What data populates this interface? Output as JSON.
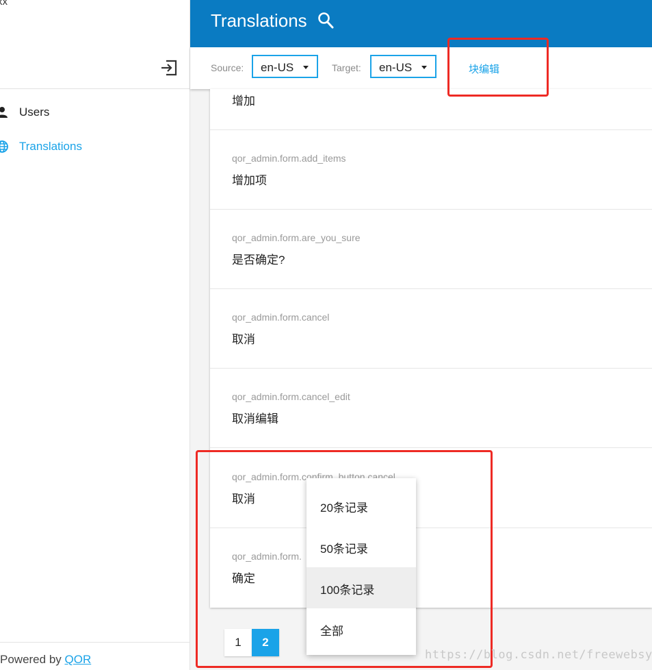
{
  "sidebar": {
    "user_name": "xx",
    "nav": [
      {
        "label": "Users",
        "icon": "user-icon"
      },
      {
        "label": "Translations",
        "icon": "globe-icon"
      }
    ],
    "footer_prefix": "Powered by ",
    "footer_link": "QOR",
    "accent_color": "#1aa3e8"
  },
  "header": {
    "title": "Translations",
    "background": "#0a7bc2"
  },
  "toolbar": {
    "source_label": "Source:",
    "source_value": "en-US",
    "target_label": "Target:",
    "target_value": "en-US",
    "bulk_edit_label": "块编辑"
  },
  "rows": [
    {
      "key": "",
      "value": "增加"
    },
    {
      "key": "qor_admin.form.add_items",
      "value": "增加项"
    },
    {
      "key": "qor_admin.form.are_you_sure",
      "value": "是否确定?"
    },
    {
      "key": "qor_admin.form.cancel",
      "value": "取消"
    },
    {
      "key": "qor_admin.form.cancel_edit",
      "value": "取消编辑"
    },
    {
      "key": "qor_admin.form.confirm_button.cancel",
      "value": "取消"
    },
    {
      "key": "qor_admin.form.",
      "value": "确定"
    }
  ],
  "pagination": {
    "pages": [
      "1",
      "2"
    ],
    "current": "2"
  },
  "per_page_menu": {
    "options": [
      "20条记录",
      "50条记录",
      "100条记录",
      "全部"
    ],
    "highlighted": "100条记录"
  },
  "watermark": "https://blog.csdn.net/freewebsys"
}
